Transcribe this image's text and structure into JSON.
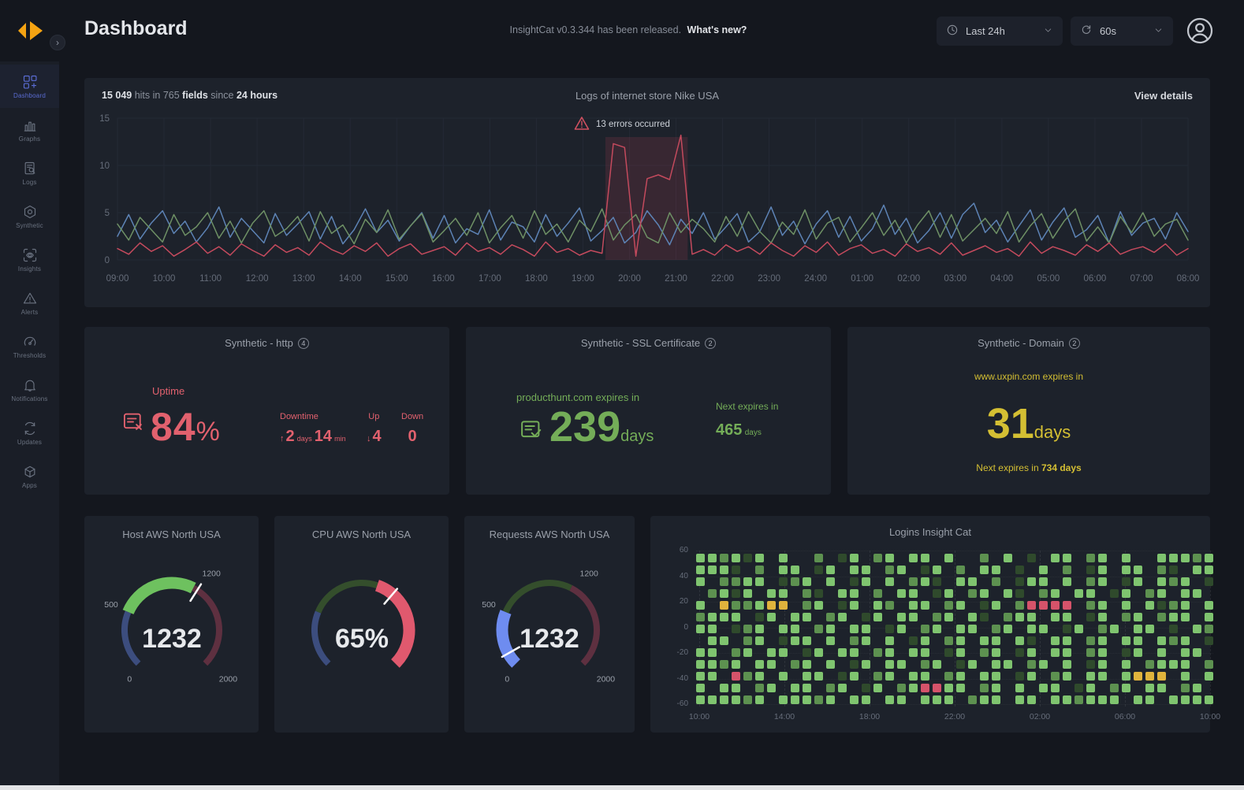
{
  "header": {
    "title": "Dashboard",
    "release_note": "InsightCat v0.3.344 has been released.",
    "whats_new": "What's new?",
    "time_range": "Last 24h",
    "refresh_interval": "60s"
  },
  "sidebar": {
    "items": [
      {
        "label": "Dashboard",
        "icon": "dashboard-icon",
        "active": true
      },
      {
        "label": "Graphs",
        "icon": "graphs-icon",
        "active": false
      },
      {
        "label": "Logs",
        "icon": "logs-icon",
        "active": false
      },
      {
        "label": "Synthetic",
        "icon": "synthetic-icon",
        "active": false
      },
      {
        "label": "Insights",
        "icon": "insights-icon",
        "active": false
      },
      {
        "label": "Alerts",
        "icon": "alerts-icon",
        "active": false
      },
      {
        "label": "Thresholds",
        "icon": "thresholds-icon",
        "active": false
      },
      {
        "label": "Notifications",
        "icon": "notifications-icon",
        "active": false
      },
      {
        "label": "Updates",
        "icon": "updates-icon",
        "active": false
      },
      {
        "label": "Apps",
        "icon": "apps-icon",
        "active": false
      }
    ]
  },
  "logs_card": {
    "stats": {
      "hits": "15 049",
      "mid1": " hits in 765 ",
      "fields": "fields",
      "mid2": " since ",
      "period": "24 hours"
    },
    "title": "Logs of internet store Nike USA",
    "view_details": "View details",
    "error_note": "13 errors occurred",
    "chart_data": {
      "type": "line",
      "x_labels": [
        "09:00",
        "10:00",
        "11:00",
        "12:00",
        "13:00",
        "14:00",
        "15:00",
        "16:00",
        "17:00",
        "18:00",
        "19:00",
        "20:00",
        "21:00",
        "22:00",
        "23:00",
        "24:00",
        "01:00",
        "02:00",
        "03:00",
        "04:00",
        "05:00",
        "06:00",
        "07:00",
        "08:00"
      ],
      "y_ticks": [
        0,
        5,
        10,
        15
      ],
      "ylim": [
        0,
        15
      ],
      "error_band": {
        "start_index": 43.3,
        "end_index": 50.6
      },
      "series": [
        {
          "name": "requests",
          "color": "#5d83b5",
          "values": [
            2.5,
            4.8,
            2.2,
            3.9,
            5.2,
            2.8,
            4.1,
            1.9,
            3.4,
            5.6,
            2.4,
            4.4,
            3.1,
            1.8,
            4.9,
            2.6,
            3.8,
            5.1,
            2.2,
            4.6,
            1.7,
            3.2,
            5.4,
            2.9,
            4.2,
            2.0,
            3.6,
            5.0,
            2.3,
            4.7,
            1.8,
            3.3,
            2.7,
            5.3,
            2.1,
            4.0,
            3.5,
            1.9,
            4.8,
            2.5,
            3.9,
            5.5,
            2.0,
            3.1,
            4.5,
            1.8,
            2.9,
            5.2,
            3.7,
            1.6,
            4.3,
            2.8,
            5.0,
            2.2,
            3.5,
            4.9,
            1.9,
            3.0,
            5.6,
            2.6,
            4.1,
            1.7,
            3.8,
            5.2,
            2.4,
            4.6,
            2.0,
            3.3,
            5.8,
            2.7,
            4.4,
            1.8,
            3.1,
            5.0,
            2.3,
            4.8,
            6.0,
            2.9,
            4.2,
            1.9,
            3.6,
            5.3,
            2.1,
            4.0,
            5.5,
            2.4,
            3.2,
            4.7,
            1.8,
            5.1,
            2.6,
            3.9,
            4.4,
            2.2,
            5.0,
            3.0
          ]
        },
        {
          "name": "responses",
          "color": "#6e9065",
          "values": [
            3.8,
            2.1,
            4.5,
            3.2,
            1.9,
            4.8,
            2.6,
            3.5,
            5.0,
            2.3,
            4.1,
            1.8,
            3.9,
            5.2,
            2.5,
            3.3,
            4.6,
            2.0,
            5.1,
            2.8,
            3.7,
            1.7,
            4.3,
            2.9,
            5.3,
            2.2,
            3.6,
            4.9,
            1.9,
            3.1,
            4.4,
            2.6,
            5.0,
            1.8,
            3.4,
            4.7,
            2.3,
            5.2,
            2.7,
            3.8,
            1.9,
            4.2,
            3.0,
            5.4,
            2.1,
            3.7,
            4.8,
            2.4,
            1.8,
            5.0,
            2.9,
            4.3,
            3.3,
            1.9,
            4.6,
            2.5,
            5.1,
            3.0,
            1.8,
            4.0,
            2.7,
            5.3,
            2.2,
            3.9,
            4.5,
            1.9,
            3.4,
            5.0,
            2.6,
            4.2,
            1.8,
            3.7,
            5.2,
            2.4,
            4.8,
            2.0,
            3.2,
            4.4,
            2.8,
            5.1,
            1.9,
            3.6,
            4.9,
            2.3,
            4.1,
            5.4,
            2.0,
            3.5,
            1.8,
            4.6,
            2.9,
            5.0,
            2.5,
            3.8,
            4.3,
            2.1
          ]
        },
        {
          "name": "errors",
          "color": "#c44a5d",
          "values": [
            1.2,
            0.6,
            1.8,
            0.9,
            1.5,
            0.4,
            1.1,
            1.9,
            0.7,
            1.4,
            0.5,
            1.7,
            1.0,
            0.4,
            1.6,
            0.8,
            1.3,
            0.5,
            1.9,
            1.1,
            0.6,
            1.5,
            0.9,
            1.8,
            0.4,
            1.2,
            1.7,
            0.6,
            1.0,
            1.4,
            0.5,
            1.8,
            0.9,
            1.3,
            0.6,
            1.6,
            1.1,
            0.4,
            1.9,
            0.8,
            1.2,
            0.5,
            1.0,
            0.7,
            12.3,
            11.9,
            0.4,
            8.6,
            9.0,
            8.5,
            13.2,
            0.6,
            1.1,
            0.5,
            1.6,
            0.9,
            1.4,
            0.6,
            1.8,
            1.0,
            0.4,
            1.5,
            0.8,
            1.9,
            0.5,
            1.2,
            1.6,
            0.7,
            1.1,
            0.4,
            1.7,
            0.9,
            1.3,
            0.6,
            1.8,
            0.5,
            1.0,
            1.5,
            0.8,
            1.2,
            0.4,
            1.9,
            0.7,
            1.4,
            1.0,
            0.5,
            1.6,
            0.9,
            1.8,
            0.6,
            1.1,
            1.4,
            0.8,
            1.7,
            0.5,
            1.2
          ]
        }
      ]
    }
  },
  "synthetic_http": {
    "title": "Synthetic - http",
    "badge": "4",
    "accent": "#e2616e",
    "uptime_label": "Uptime",
    "uptime_value": "84",
    "uptime_unit": "%",
    "downtime_label": "Downtime",
    "downtime_arrow": "↑",
    "downtime_days": "2",
    "downtime_days_unit": "days",
    "downtime_min": "14",
    "downtime_min_unit": "min",
    "up_label": "Up",
    "up_arrow": "↓",
    "up_value": "4",
    "down_label": "Down",
    "down_value": "0"
  },
  "synthetic_ssl": {
    "title": "Synthetic - SSL Certificate",
    "badge": "2",
    "accent": "#74ad58",
    "expires_label": "producthunt.com expires in",
    "days_value": "239",
    "days_unit": "days",
    "next_label": "Next expires in",
    "next_value": "465",
    "next_unit": "days"
  },
  "synthetic_domain": {
    "title": "Synthetic - Domain",
    "badge": "2",
    "accent": "#d4bf33",
    "expires_label": "www.uxpin.com expires in",
    "days_value": "31",
    "days_unit": "days",
    "next_prefix": "Next expires in ",
    "next_bold": "734 days"
  },
  "gauges": [
    {
      "title": "Host AWS North USA",
      "value_label": "1232",
      "min": 0,
      "max": 2000,
      "needle": 1240,
      "segments": [
        {
          "from": 0,
          "to": 500,
          "color": "#3c4d7e",
          "thick": false
        },
        {
          "from": 500,
          "to": 1200,
          "color": "#6ec15f",
          "thick": true
        },
        {
          "from": 1200,
          "to": 2000,
          "color": "#5e3040",
          "thick": false
        }
      ],
      "labels": [
        {
          "value": 0,
          "text": "0"
        },
        {
          "value": 500,
          "text": "500"
        },
        {
          "value": 1200,
          "text": "1200"
        },
        {
          "value": 2000,
          "text": "2000"
        }
      ]
    },
    {
      "title": "CPU AWS North USA",
      "value_label": "65%",
      "min": 0,
      "max": 100,
      "needle": 65,
      "segments": [
        {
          "from": 0,
          "to": 25,
          "color": "#3c4d7e",
          "thick": false
        },
        {
          "from": 25,
          "to": 57,
          "color": "#344e2c",
          "thick": false
        },
        {
          "from": 57,
          "to": 100,
          "color": "#e0596e",
          "thick": true
        }
      ],
      "labels": []
    },
    {
      "title": "Requests AWS North USA",
      "value_label": "1232",
      "min": 0,
      "max": 2000,
      "needle": 115,
      "segments": [
        {
          "from": 0,
          "to": 500,
          "color": "#6e8cf0",
          "thick": true
        },
        {
          "from": 500,
          "to": 1200,
          "color": "#344e2c",
          "thick": false
        },
        {
          "from": 1200,
          "to": 2000,
          "color": "#5e3040",
          "thick": false
        }
      ],
      "labels": [
        {
          "value": 0,
          "text": "0"
        },
        {
          "value": 500,
          "text": "500"
        },
        {
          "value": 1200,
          "text": "1200"
        },
        {
          "value": 2000,
          "text": "2000"
        }
      ]
    }
  ],
  "heatmap_card": {
    "title": "Logins Insight Cat",
    "chart_data": {
      "type": "heatmap",
      "y_ticks": [
        "60",
        "40",
        "20",
        "0",
        "-20",
        "-40",
        "-60"
      ],
      "x_labels": [
        "10:00",
        "14:00",
        "18:00",
        "22:00",
        "02:00",
        "06:00",
        "10:00"
      ],
      "palette": {
        "2": "#2f4a2c",
        "3": "#5d9150",
        "4": "#7fc46f",
        "Y": "#e0b33c",
        "R": "#d5536a"
      },
      "rows": [
        "443424.4..3.24.34.44.4..3.4.2.44.34.4..44434",
        "4442.3.44.24.44.34.24.3.44.2.4.3.24.44.32.44",
        "4.3344.234.4.24.4.342.44.3.244.4.34.24.434.2",
        ".3424.44.32.44.3.44.24.34.42.34.44.24.34.44.",
        "4.Y334YY.34.24.43.44.34.24.3RRRR.34.4.4234.4",
        "3444.24.44.34.24.44.34.42.344.44.24.34.344.4",
        "44.234.44.34.44.24.34.44.34.44.24.34.44.2.43",
        ".44.34.244.4.34.4.24.34.44.42.44.34.44.434.2",
        "44.34.44.24.44.34.44.24.34.24.44.34.24.4.44.",
        "4434.44.34.4.24.44.34.24.44.34.4.24.4.3444.3",
        "44.R34.4.44.24.34.44.34.44.24.34.44.4YYY.4.4",
        "4.44.34.44.34.24.34RR44.34.4.44.24.34.44.34.",
        "444434.44434.44.44.444.344.44.443444.44.4444"
      ]
    }
  }
}
